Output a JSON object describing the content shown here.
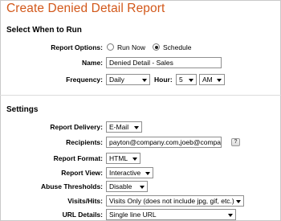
{
  "page": {
    "title": "Create Denied Detail Report"
  },
  "schedule_section": {
    "title": "Select When to Run",
    "report_options": {
      "label": "Report Options:",
      "run_now_label": "Run Now",
      "schedule_label": "Schedule",
      "selected": "Schedule"
    },
    "name": {
      "label": "Name:",
      "value": "Denied Detail - Sales"
    },
    "frequency": {
      "label": "Frequency:",
      "value": "Daily",
      "hour_label": "Hour:",
      "hour_value": "5",
      "ampm_value": "AM"
    }
  },
  "settings_section": {
    "title": "Settings",
    "report_delivery": {
      "label": "Report Delivery:",
      "value": "E-Mail"
    },
    "recipients": {
      "label": "Recipients:",
      "value": "payton@company.com,joeb@company.com",
      "help": "?"
    },
    "report_format": {
      "label": "Report Format:",
      "value": "HTML"
    },
    "report_view": {
      "label": "Report View:",
      "value": "Interactive"
    },
    "abuse_thresholds": {
      "label": "Abuse Thresholds:",
      "value": "Disable"
    },
    "visits_hits": {
      "label": "Visits/Hits:",
      "value": "Visits Only (does not include jpg, gif, etc.)"
    },
    "url_details": {
      "label": "URL Details:",
      "value": "Single line URL"
    }
  },
  "colors": {
    "title": "#d2581a",
    "border": "#8f8f8f"
  }
}
